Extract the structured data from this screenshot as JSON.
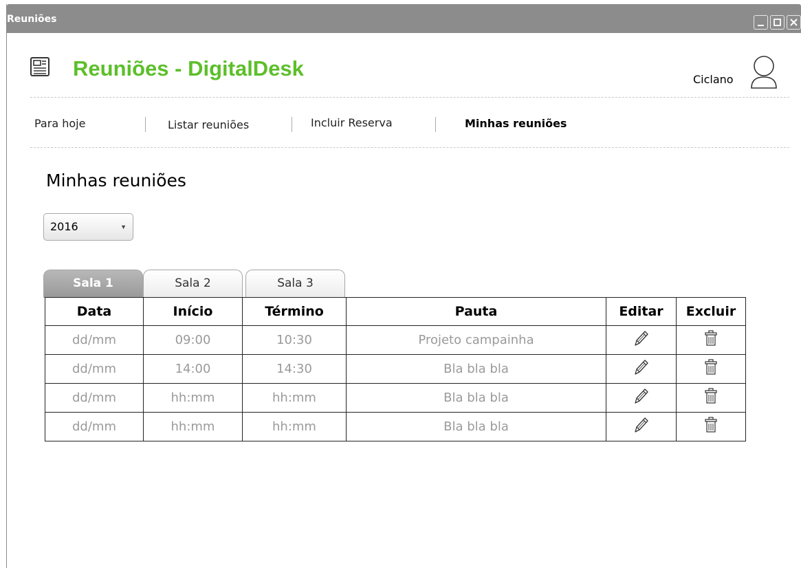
{
  "window": {
    "title": "Reuniões"
  },
  "header": {
    "app_title": "Reuniões - DigitalDesk",
    "user_name": "Ciclano"
  },
  "nav": {
    "items": [
      {
        "label": "Para hoje"
      },
      {
        "label": "Listar reuniões"
      },
      {
        "label": "Incluir Reserva"
      },
      {
        "label": "Minhas reuniões",
        "active": true
      }
    ]
  },
  "page": {
    "title": "Minhas reuniões"
  },
  "year_select": {
    "value": "2016"
  },
  "tabs": [
    {
      "label": "Sala 1",
      "active": true
    },
    {
      "label": "Sala 2"
    },
    {
      "label": "Sala 3"
    }
  ],
  "table": {
    "headers": [
      "Data",
      "Início",
      "Término",
      "Pauta",
      "Editar",
      "Excluir"
    ],
    "rows": [
      [
        "dd/mm",
        "09:00",
        "10:30",
        "Projeto campainha"
      ],
      [
        "dd/mm",
        "14:00",
        "14:30",
        "Bla bla bla"
      ],
      [
        "dd/mm",
        "hh:mm",
        "hh:mm",
        "Bla bla bla"
      ],
      [
        "dd/mm",
        "hh:mm",
        "hh:mm",
        "Bla bla bla"
      ]
    ],
    "edit_icon": "pencil-icon",
    "delete_icon": "trash-icon"
  },
  "colors": {
    "brand": "#5cbf2a",
    "titlebar": "#8c8c8c",
    "active_tab": "#a8a8a8",
    "cell_text": "#9a9a9a"
  }
}
